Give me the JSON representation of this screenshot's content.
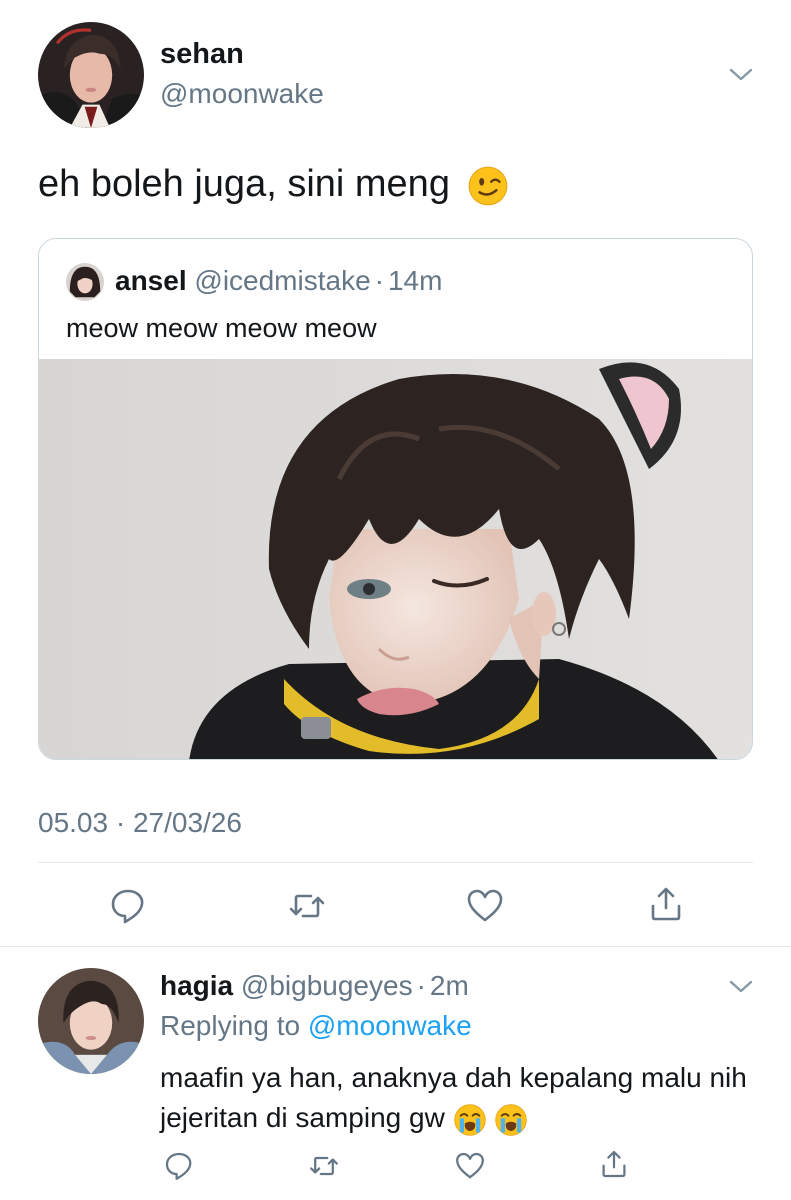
{
  "main_tweet": {
    "display_name": "sehan",
    "handle": "@moonwake",
    "text": "eh boleh juga, sini meng",
    "text_emoji": "winking-face",
    "timestamp": "05.03 · 27/03/26"
  },
  "quoted_tweet": {
    "display_name": "ansel",
    "handle": "@icedmistake",
    "separator": "·",
    "time": "14m",
    "text": "meow meow meow meow"
  },
  "reply": {
    "display_name": "hagia",
    "handle": "@bigbugeyes",
    "separator": "·",
    "time": "2m",
    "replying_label": "Replying to",
    "replying_to": "@moonwake",
    "text": "maafin ya han, anaknya dah kepalang malu nih jejeritan di samping gw",
    "text_emoji": "loudly-crying-face x2"
  },
  "icons": [
    "chevron-down-icon",
    "reply-icon",
    "retweet-icon",
    "like-icon",
    "share-icon"
  ],
  "colors": {
    "text": "#14171a",
    "secondary": "#657786",
    "link": "#1da1f2",
    "border": "#ccd6dd",
    "divider": "#e1e8ed"
  }
}
